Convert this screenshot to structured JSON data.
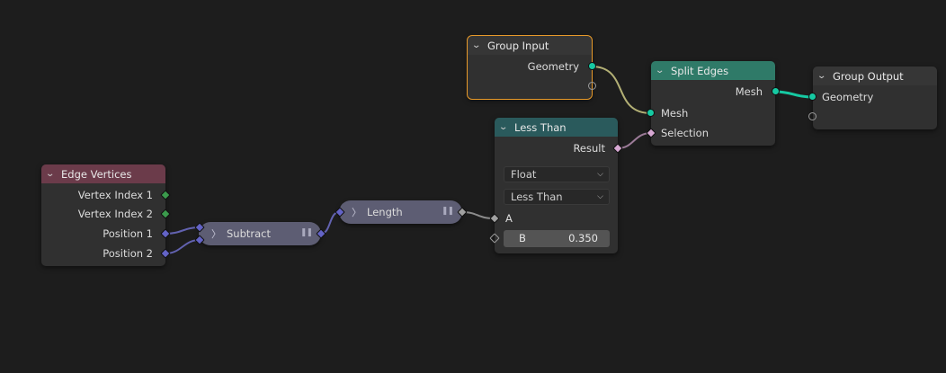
{
  "nodes": {
    "group_input": {
      "title": "Group Input",
      "outputs": [
        "Geometry"
      ]
    },
    "split_edges": {
      "title": "Split Edges",
      "output": "Mesh",
      "inputs": [
        "Mesh",
        "Selection"
      ]
    },
    "group_output": {
      "title": "Group Output",
      "input": "Geometry"
    },
    "less_than": {
      "title": "Less Than",
      "output": "Result",
      "data_type": "Float",
      "operation": "Less Than",
      "input_a": "A",
      "input_b_label": "B",
      "input_b_value": "0.350"
    },
    "edge_vertices": {
      "title": "Edge Vertices",
      "outputs": [
        "Vertex Index 1",
        "Vertex Index 2",
        "Position 1",
        "Position 2"
      ]
    },
    "subtract": {
      "title": "Subtract"
    },
    "length": {
      "title": "Length"
    }
  },
  "colors": {
    "background": "#1d1d1d",
    "geometry_header": "#2f7a68",
    "math_header": "#2a5a5c",
    "input_header": "#6b3b4a",
    "group_header": "#363636",
    "selected_outline": "#e89a2a",
    "geometry_socket": "#16c9a2",
    "boolean_socket": "#d7a8d3",
    "integer_socket": "#3b9a4c",
    "vector_socket": "#6363c6",
    "float_socket": "#a1a1a1"
  }
}
